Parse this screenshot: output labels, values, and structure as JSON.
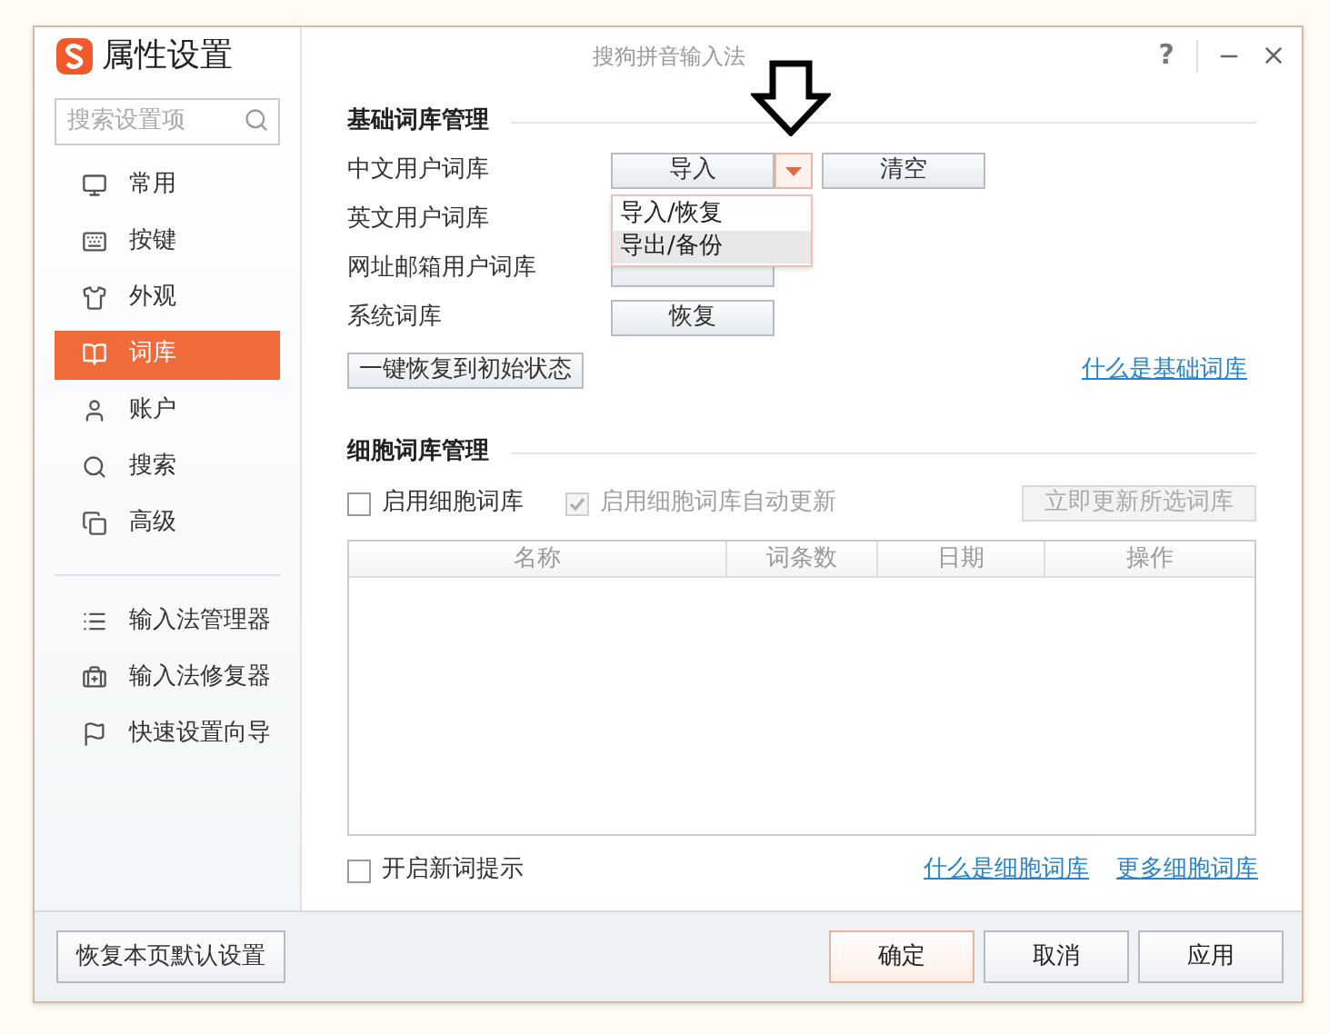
{
  "window": {
    "title": "属性设置",
    "subtitle": "搜狗拼音输入法",
    "help": "?"
  },
  "sidebar": {
    "search": {
      "placeholder": "搜索设置项"
    },
    "items": [
      {
        "label": "常用",
        "selected": false
      },
      {
        "label": "按键",
        "selected": false
      },
      {
        "label": "外观",
        "selected": false
      },
      {
        "label": "词库",
        "selected": true
      },
      {
        "label": "账户",
        "selected": false
      },
      {
        "label": "搜索",
        "selected": false
      },
      {
        "label": "高级",
        "selected": false
      }
    ],
    "tools": [
      {
        "label": "输入法管理器"
      },
      {
        "label": "输入法修复器"
      },
      {
        "label": "快速设置向导"
      }
    ]
  },
  "basic": {
    "title": "基础词库管理",
    "rows": [
      {
        "label": "中文用户词库",
        "buttons": [
          "导入",
          "清空"
        ],
        "dropdown": true
      },
      {
        "label": "英文用户词库",
        "buttons": []
      },
      {
        "label": "网址邮箱用户词库",
        "buttons": [],
        "covered_button": true
      },
      {
        "label": "系统词库",
        "buttons": [
          "恢复"
        ]
      }
    ],
    "menu": [
      {
        "label": "导入/恢复",
        "selected": false
      },
      {
        "label": "导出/备份",
        "selected": true
      }
    ],
    "reset_button": "一键恢复到初始状态",
    "link": "什么是基础词库"
  },
  "cell": {
    "title": "细胞词库管理",
    "enable": {
      "label": "启用细胞词库",
      "checked": false,
      "disabled": false
    },
    "auto_update": {
      "label": "启用细胞词库自动更新",
      "checked": true,
      "disabled": true
    },
    "update_button": {
      "label": "立即更新所选词库",
      "disabled": true
    },
    "table": {
      "columns": [
        "名称",
        "词条数",
        "日期",
        "操作"
      ]
    },
    "new_word": {
      "label": "开启新词提示",
      "checked": false,
      "disabled": false
    },
    "links": [
      "什么是细胞词库",
      "更多细胞词库"
    ]
  },
  "footer": {
    "defaults_button": "恢复本页默认设置",
    "buttons": [
      {
        "label": "确定",
        "primary": true
      },
      {
        "label": "取消",
        "primary": false
      },
      {
        "label": "应用",
        "primary": false
      }
    ]
  }
}
